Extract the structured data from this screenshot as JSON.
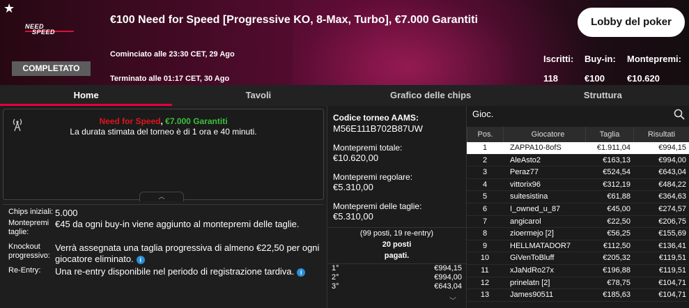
{
  "header": {
    "title": "€100 Need for Speed [Progressive KO, 8-Max, Turbo], €7.000 Garantiti",
    "logo_line1": "NEED",
    "logo_line2": "SPEED",
    "status_badge": "COMPLETATO",
    "started": "Cominciato alle 23:30 CET, 29 Ago",
    "ended": "Terminato alle 01:17 CET, 30 Ago",
    "lobby_button": "Lobby del poker",
    "stats": {
      "iscritti_label": "Iscritti:",
      "iscritti_value": "118",
      "buyin_label": "Buy-in:",
      "buyin_value": "€100",
      "montepremi_label": "Montepremi:",
      "montepremi_value": "€10.620"
    }
  },
  "tabs": [
    {
      "label": "Home",
      "active": true
    },
    {
      "label": "Tavoli",
      "active": false
    },
    {
      "label": "Grafico delle chips",
      "active": false
    },
    {
      "label": "Struttura",
      "active": false
    }
  ],
  "info": {
    "name_red": "Need for Speed",
    "name_sep": ", ",
    "name_green": "€7.000 Garantiti",
    "duration": "La durata stimata del torneo è di 1 ora e 40 minuti."
  },
  "details": {
    "chips_label": "Chips iniziali:",
    "chips_value": "5.000",
    "taglie_label": "Montepremi taglie:",
    "taglie_value": "€45 da ogni buy-in viene aggiunto al montepremi delle taglie.",
    "ko_label": "Knockout progressivo:",
    "ko_value": "Verrà assegnata una taglia progressiva di almeno €22,50 per ogni giocatore eliminato.",
    "reentry_label": "Re-Entry:",
    "reentry_value": "Una re-entry disponibile nel periodo di registrazione tardiva."
  },
  "middle": {
    "aams_label": "Codice torneo AAMS:",
    "aams_value": "M56E111B702B87UW",
    "total_label": "Montepremi totale:",
    "total_value": "€10.620,00",
    "regular_label": "Montepremi regolare:",
    "regular_value": "€5.310,00",
    "bounty_label": "Montepremi delle taglie:",
    "bounty_value": "€5.310,00",
    "posti_line1": "(99 posti, 19 re-entry)",
    "posti_line2": "20 posti",
    "posti_line3": "pagati.",
    "prizes": [
      {
        "pos": "1°",
        "amount": "€994,15"
      },
      {
        "pos": "2°",
        "amount": "€994,00"
      },
      {
        "pos": "3°",
        "amount": "€643,04"
      }
    ]
  },
  "players": {
    "search_label": "Gioc.",
    "columns": [
      "Pos.",
      "Giocatore",
      "Taglia",
      "Risultati"
    ],
    "rows": [
      {
        "pos": "1",
        "name": "ZAPPA10-8ofS",
        "bounty": "€1.911,04",
        "result": "€994,15"
      },
      {
        "pos": "2",
        "name": "AleAsto2",
        "bounty": "€163,13",
        "result": "€994,00"
      },
      {
        "pos": "3",
        "name": "Peraz77",
        "bounty": "€524,54",
        "result": "€643,04"
      },
      {
        "pos": "4",
        "name": "vittorix96",
        "bounty": "€312,19",
        "result": "€484,22"
      },
      {
        "pos": "5",
        "name": "suitesistina",
        "bounty": "€61,88",
        "result": "€364,63"
      },
      {
        "pos": "6",
        "name": "I_owned_u_87",
        "bounty": "€45,00",
        "result": "€274,57"
      },
      {
        "pos": "7",
        "name": "angicarol",
        "bounty": "€22,50",
        "result": "€206,75"
      },
      {
        "pos": "8",
        "name": "zioermejo [2]",
        "bounty": "€56,25",
        "result": "€155,69"
      },
      {
        "pos": "9",
        "name": "HELLMATADOR7",
        "bounty": "€112,50",
        "result": "€136,41"
      },
      {
        "pos": "10",
        "name": "GiVenToBluff",
        "bounty": "€205,32",
        "result": "€119,51"
      },
      {
        "pos": "11",
        "name": "xJaNdRo27x",
        "bounty": "€196,88",
        "result": "€119,51"
      },
      {
        "pos": "12",
        "name": "prinelatn [2]",
        "bounty": "€78,75",
        "result": "€104,71"
      },
      {
        "pos": "13",
        "name": "James90511",
        "bounty": "€185,63",
        "result": "€104,71"
      }
    ]
  }
}
